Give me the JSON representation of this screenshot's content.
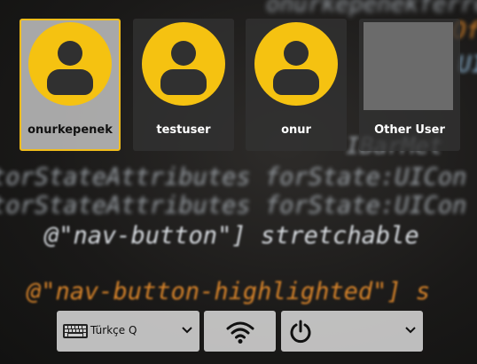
{
  "users": [
    {
      "name": "onurkepenek",
      "selected": true,
      "avatar": "user-avatar-icon"
    },
    {
      "name": "testuser",
      "selected": false,
      "avatar": "user-avatar-icon"
    },
    {
      "name": "onur",
      "selected": false,
      "avatar": "user-avatar-icon"
    },
    {
      "name": "Other User",
      "selected": false,
      "avatar": "blank-avatar"
    }
  ],
  "panel": {
    "keyboard_layout": "Türkçe Q",
    "keyboard_icon": "keyboard-icon",
    "network_icon": "wifi-icon",
    "power_icon": "power-icon",
    "dropdown_icon": "chevron-down-icon"
  },
  "background": {
    "lines": [
      "onurkepenekferrectorno",
      "Of",
      "UI",
      "IBarMet",
      "torStateAttributes forState:UICon",
      "torStateAttributes forState:UICon",
      "@\"nav-button\"] stretchable",
      "@\"nav-button-highlighted\"] s"
    ]
  },
  "colors": {
    "accent": "#f1bd1c",
    "avatar": "#f5c211",
    "tile": "#323232",
    "panel": "#cdcdcd"
  }
}
